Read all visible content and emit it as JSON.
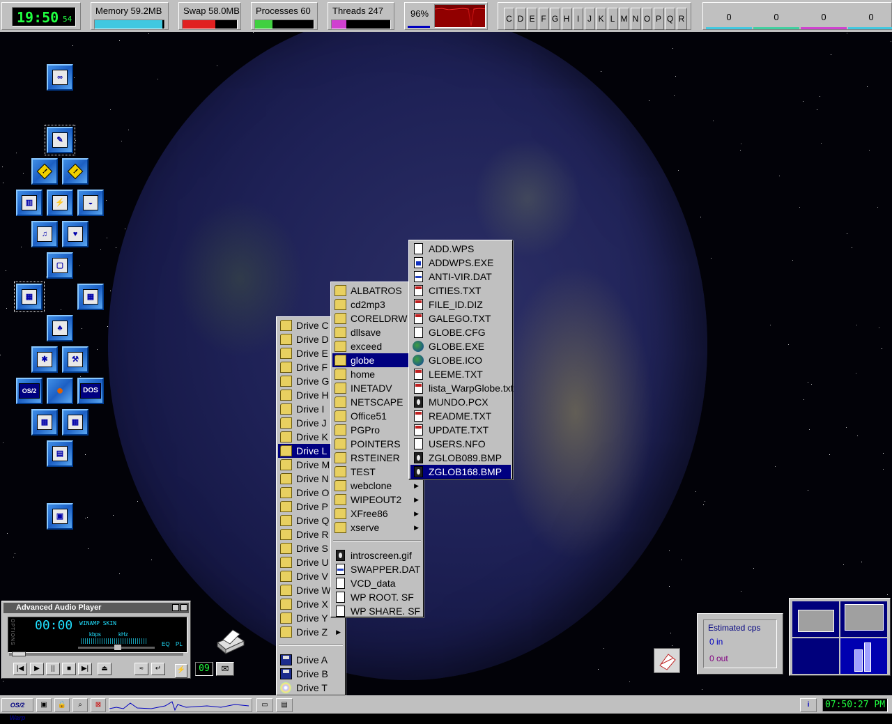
{
  "topbar": {
    "clock": {
      "hhmm": "19:50",
      "sec": "54"
    },
    "memory": {
      "label": "Memory 59.2MB",
      "fill": 0.97
    },
    "swap": {
      "label": "Swap 58.0MB",
      "fill": 0.6
    },
    "processes": {
      "label": "Processes 60",
      "fill": 0.3
    },
    "threads": {
      "label": "Threads 247",
      "fill": 0.25
    },
    "cpu": {
      "label": "96%"
    },
    "drives": [
      "C",
      "D",
      "E",
      "F",
      "G",
      "H",
      "I",
      "J",
      "K",
      "L",
      "M",
      "N",
      "O",
      "P",
      "Q",
      "R"
    ],
    "net": [
      "0",
      "0",
      "0",
      "0"
    ],
    "colors": {
      "memory": "#40c8e0",
      "swap": "#e02020",
      "processes": "#40d040",
      "threads": "#d040d0",
      "cpu_graph": "#c00000"
    }
  },
  "desktop_icons": [
    "launchpad-icon",
    "pencil-icon",
    "warning-icon",
    "warning-icon",
    "keyboard-icon",
    "network-icon",
    "balloon-icon",
    "music-note-icon",
    "cards-icon",
    "monitor-icon",
    "graph-icon",
    "graph-icon",
    "tree-icon",
    "bug-icon",
    "wrench-icon",
    "os2-icon",
    "apple-icon",
    "dos-icon",
    "grid-icon",
    "grid-icon",
    "drawer-icon",
    "tape-icon"
  ],
  "desktop_icon_labels": {
    "os2": "OS/2",
    "dos": "DOS"
  },
  "drives_menu": {
    "items": [
      "Drive C",
      "Drive D",
      "Drive E",
      "Drive F",
      "Drive G",
      "Drive H",
      "Drive I",
      "Drive J",
      "Drive K",
      "Drive L",
      "Drive M",
      "Drive N",
      "Drive O",
      "Drive P",
      "Drive Q",
      "Drive R",
      "Drive S",
      "Drive U",
      "Drive V",
      "Drive W",
      "Drive X",
      "Drive Y",
      "Drive Z"
    ],
    "selected_index": 9,
    "removable": [
      "Drive A",
      "Drive B",
      "Drive T"
    ]
  },
  "folders_menu": {
    "folders": [
      "ALBATROS",
      "cd2mp3",
      "CORELDRW",
      "dllsave",
      "exceed",
      "globe",
      "home",
      "INETADV",
      "NETSCAPE",
      "Office51",
      "PGPro",
      "POINTERS",
      "RSTEINER",
      "TEST",
      "webclone",
      "WIPEOUT2",
      "XFree86",
      "xserve"
    ],
    "submenu_folders": [
      "webclone",
      "WIPEOUT2",
      "XFree86",
      "xserve"
    ],
    "selected": "globe",
    "files": [
      "introscreen.gif",
      "SWAPPER.DAT",
      "VCD_data",
      "WP ROOT. SF",
      "WP SHARE. SF"
    ]
  },
  "files_menu": {
    "items": [
      {
        "name": "ADD.WPS",
        "type": "doc"
      },
      {
        "name": "ADDWPS.EXE",
        "type": "exe"
      },
      {
        "name": "ANTI-VIR.DAT",
        "type": "dat"
      },
      {
        "name": "CITIES.TXT",
        "type": "txt"
      },
      {
        "name": "FILE_ID.DIZ",
        "type": "txt"
      },
      {
        "name": "GALEGO.TXT",
        "type": "txt"
      },
      {
        "name": "GLOBE.CFG",
        "type": "doc"
      },
      {
        "name": "GLOBE.EXE",
        "type": "glb"
      },
      {
        "name": "GLOBE.ICO",
        "type": "glb"
      },
      {
        "name": "LEEME.TXT",
        "type": "txt"
      },
      {
        "name": "lista_WarpGlobe.txt",
        "type": "txt"
      },
      {
        "name": "MUNDO.PCX",
        "type": "img"
      },
      {
        "name": "README.TXT",
        "type": "txt"
      },
      {
        "name": "UPDATE.TXT",
        "type": "txt"
      },
      {
        "name": "USERS.NFO",
        "type": "doc"
      },
      {
        "name": "ZGLOB089.BMP",
        "type": "img"
      },
      {
        "name": "ZGLOB168.BMP",
        "type": "img"
      }
    ],
    "selected": "ZGLOB168.BMP"
  },
  "player": {
    "title": "Advanced Audio Player",
    "time": "00:00",
    "skin": "WINAMP SKIN",
    "kbps": "kbps",
    "khz": "kHz",
    "eq": "EQ",
    "pl": "PL",
    "side": "OPTIONS",
    "buttons": [
      "prev",
      "play",
      "pause",
      "stop",
      "next",
      "eject"
    ],
    "track": "09"
  },
  "cps": {
    "title": "Estimated cps",
    "in": "0 in",
    "out": "0 out"
  },
  "taskbar": {
    "logo": "OS/2 Warp",
    "clock": "07:50:27 PM"
  }
}
